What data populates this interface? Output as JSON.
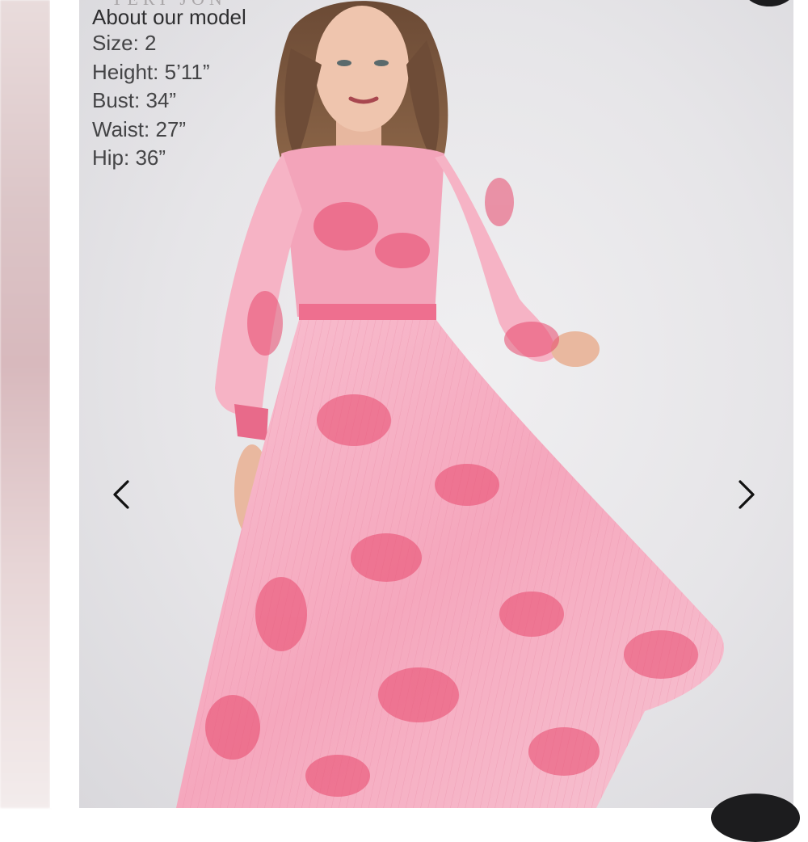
{
  "photo": {
    "brand_watermark": "TERI JON",
    "model_info": {
      "heading": "About our model",
      "lines": [
        "Size: 2",
        "Height: 5’11”",
        "Bust: 34”",
        "Waist: 27”",
        "Hip: 36”"
      ]
    },
    "nav": {
      "prev_icon": "chevron-left-icon",
      "next_icon": "chevron-right-icon"
    }
  },
  "colors": {
    "background_gray": "#e6e5e8",
    "dress_pink_light": "#f6b6c8",
    "dress_pink_dark": "#e8476b",
    "text": "#3a3a3c"
  }
}
